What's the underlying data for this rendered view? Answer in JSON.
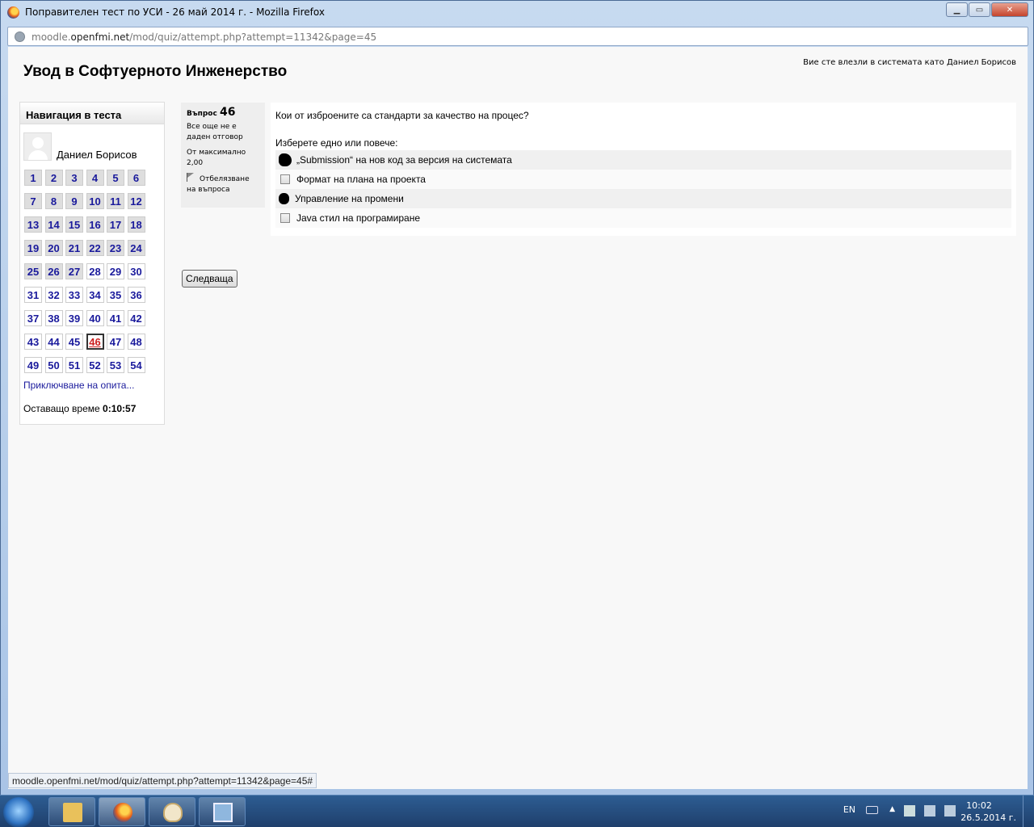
{
  "window": {
    "title": "Поправителен тест по УСИ - 26 май 2014 г. - Mozilla Firefox",
    "url_domain": "moodle.",
    "url_host": "openfmi.net",
    "url_path": "/mod/quiz/attempt.php?attempt=11342&page=45"
  },
  "header": {
    "course_title": "Увод в Софтуерното Инженерство",
    "logged_in": "Вие сте влезли в системата като Даниел Борисов"
  },
  "nav": {
    "title": "Навигация в теста",
    "username": "Даниел Борисов",
    "questions": [
      "1",
      "2",
      "3",
      "4",
      "5",
      "6",
      "7",
      "8",
      "9",
      "10",
      "11",
      "12",
      "13",
      "14",
      "15",
      "16",
      "17",
      "18",
      "19",
      "20",
      "21",
      "22",
      "23",
      "24",
      "25",
      "26",
      "27",
      "28",
      "29",
      "30",
      "31",
      "32",
      "33",
      "34",
      "35",
      "36",
      "37",
      "38",
      "39",
      "40",
      "41",
      "42",
      "43",
      "44",
      "45",
      "46",
      "47",
      "48",
      "49",
      "50",
      "51",
      "52",
      "53",
      "54"
    ],
    "current": "46",
    "finish_link": "Приключване на опита...",
    "time_label": "Оставащо време",
    "time_value": "0:10:57"
  },
  "question": {
    "label": "Въпрос",
    "number": "46",
    "state": "Все още не е даден отговор",
    "grade": "От максимално 2,00",
    "flag": "Отбелязване на въпроса",
    "text": "Кои от изброените са стандарти за качество на процес?",
    "prompt": "Изберете едно или повече:",
    "answers": [
      "„Submission“ на нов код за версия на системата",
      "Формат на плана на проекта",
      "Управление на промени",
      "Java стил на програмиране"
    ]
  },
  "next_button": "Следваща",
  "status_url": "moodle.openfmi.net/mod/quiz/attempt.php?attempt=11342&page=45#",
  "taskbar": {
    "lang": "EN",
    "time": "10:02",
    "date": "26.5.2014 г."
  }
}
